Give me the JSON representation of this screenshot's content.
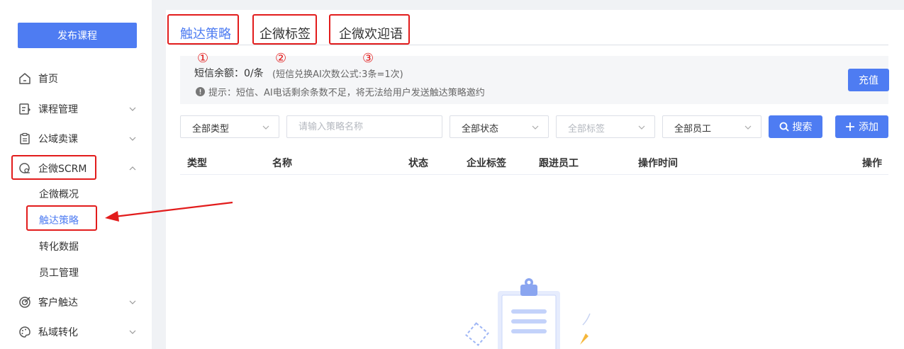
{
  "sidebar": {
    "publish_button": "发布课程",
    "items": [
      {
        "label": "首页",
        "icon": "home-icon"
      },
      {
        "label": "课程管理",
        "icon": "course-icon"
      },
      {
        "label": "公域卖课",
        "icon": "clipboard-icon"
      },
      {
        "label": "企微SCRM",
        "icon": "scrm-icon"
      },
      {
        "label": "客户触达",
        "icon": "target-icon"
      },
      {
        "label": "私域转化",
        "icon": "palette-icon"
      }
    ],
    "sub_items": [
      "企微概况",
      "触达策略",
      "转化数据",
      "员工管理"
    ]
  },
  "tabs": [
    "触达策略",
    "企微标签",
    "企微欢迎语"
  ],
  "annotations": [
    "①",
    "②",
    "③"
  ],
  "notice": {
    "balance": "短信余额：0/条",
    "formula": "(短信兑换AI次数公式:3条=1次)",
    "tip": "提示：短信、AI电话剩余条数不足，将无法给用户发送触达策略邀约",
    "recharge_button": "充值"
  },
  "filters": {
    "type": "全部类型",
    "name_placeholder": "请输入策略名称",
    "status": "全部状态",
    "tag": "全部标签",
    "staff": "全部员工",
    "search_button": "搜索",
    "add_button": "添加"
  },
  "table": {
    "columns": [
      "类型",
      "名称",
      "状态",
      "企业标签",
      "跟进员工",
      "操作时间",
      "操作"
    ]
  },
  "colors": {
    "accent": "#4e7cf2",
    "annotation": "#e21c1c"
  }
}
